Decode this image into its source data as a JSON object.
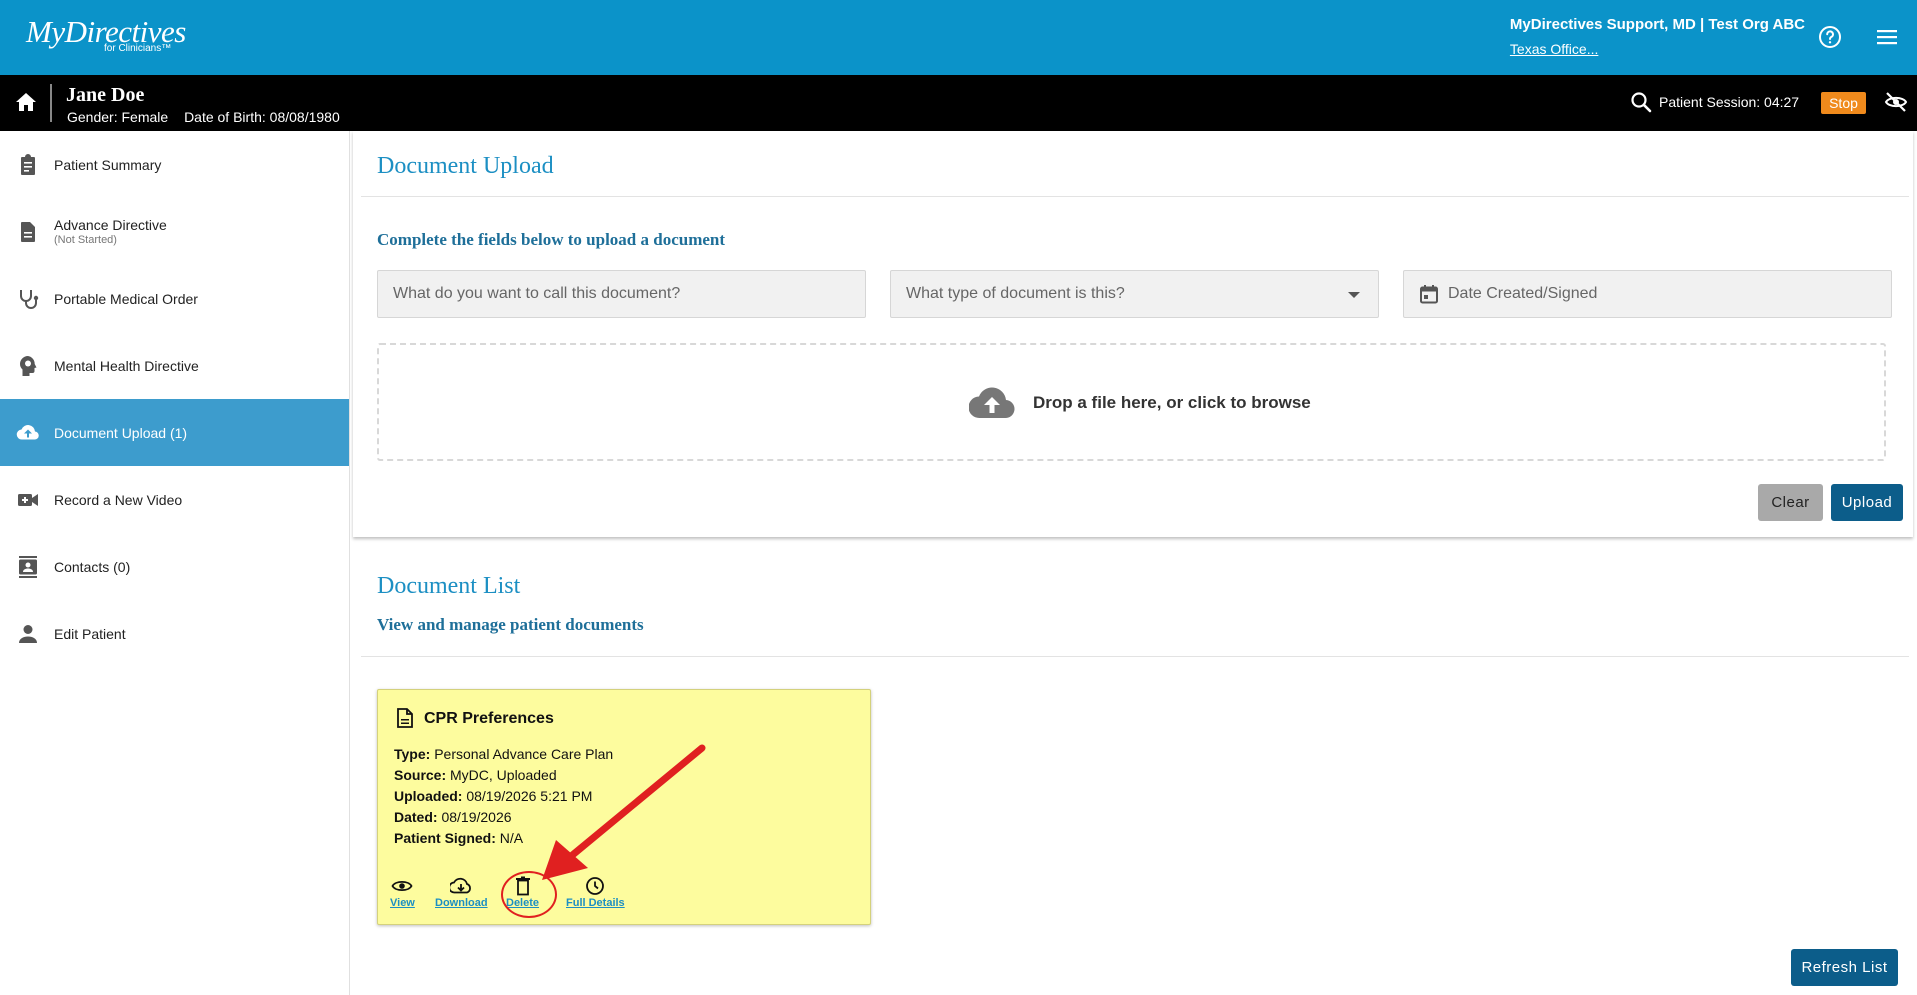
{
  "header": {
    "logo_main": "MyDirectives",
    "logo_sub": "for Clinicians™",
    "user_name": "MyDirectives Support, MD | Test Org ABC",
    "org_link": "Texas Office..."
  },
  "patient": {
    "name": "Jane Doe",
    "gender": "Gender: Female",
    "dob": "Date of Birth: 08/08/1980",
    "session_label": "Patient Session: 04:27",
    "stop_label": "Stop"
  },
  "sidebar": {
    "items": [
      {
        "label": "Patient Summary",
        "sub": "",
        "icon": "clipboard-icon"
      },
      {
        "label": "Advance Directive",
        "sub": "(Not Started)",
        "icon": "document-icon"
      },
      {
        "label": "Portable Medical Order",
        "sub": "",
        "icon": "stethoscope-icon"
      },
      {
        "label": "Mental Health Directive",
        "sub": "",
        "icon": "head-brain-icon"
      },
      {
        "label": "Document Upload (1)",
        "sub": "",
        "icon": "cloud-upload-icon",
        "active": true
      },
      {
        "label": "Record a New Video",
        "sub": "",
        "icon": "video-camera-icon"
      },
      {
        "label": "Contacts (0)",
        "sub": "",
        "icon": "contacts-icon"
      },
      {
        "label": "Edit Patient",
        "sub": "",
        "icon": "person-icon"
      }
    ]
  },
  "upload": {
    "title": "Document Upload",
    "subtitle": "Complete the fields below to upload a document",
    "name_placeholder": "What do you want to call this document?",
    "type_placeholder": "What type of document is this?",
    "date_placeholder": "Date Created/Signed",
    "drop_text": "Drop a file here, or click to browse",
    "clear_label": "Clear",
    "upload_label": "Upload"
  },
  "list": {
    "title": "Document List",
    "subtitle": "View and manage patient documents",
    "refresh_label": "Refresh List",
    "doc": {
      "title": "CPR Preferences",
      "type_label": "Type:",
      "type_value": "Personal Advance Care Plan",
      "source_label": "Source:",
      "source_value": "MyDC, Uploaded",
      "uploaded_label": "Uploaded:",
      "uploaded_value": "08/19/2026 5:21 PM",
      "dated_label": "Dated:",
      "dated_value": "08/19/2026",
      "signed_label": "Patient Signed:",
      "signed_value": "N/A",
      "actions": {
        "view": "View",
        "download": "Download",
        "delete": "Delete",
        "details": "Full Details"
      }
    }
  },
  "colors": {
    "header_blue": "#0b93c9",
    "accent_dark": "#0c5d8a",
    "active_nav": "#3d9ccd",
    "stop_orange": "#f08a1c",
    "card_yellow": "#fdfc9e",
    "annotation_red": "#e02020"
  }
}
